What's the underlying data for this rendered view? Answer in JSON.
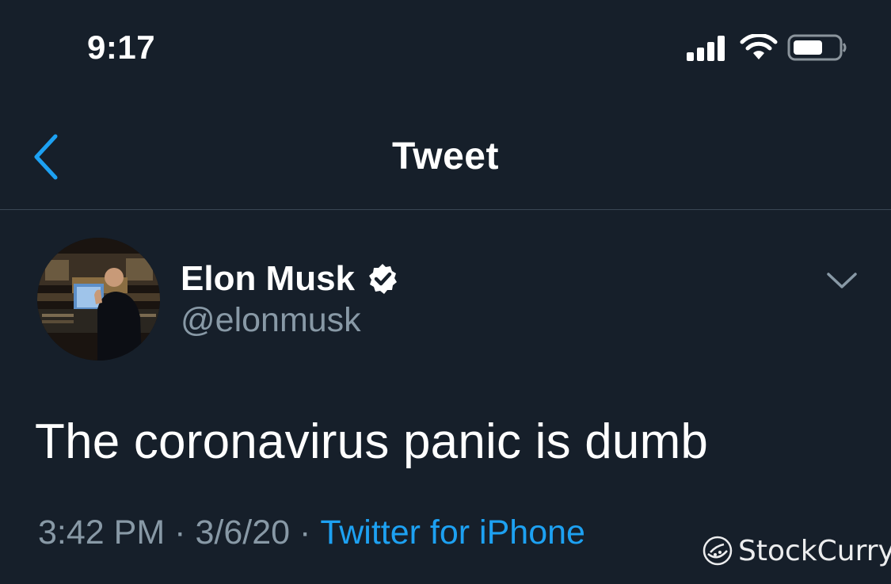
{
  "status_bar": {
    "time": "9:17",
    "icons": [
      "cellular-signal-icon",
      "wifi-icon",
      "battery-icon"
    ]
  },
  "nav": {
    "back_icon": "chevron-left-icon",
    "title": "Tweet"
  },
  "tweet": {
    "author": {
      "display_name": "Elon Musk",
      "verified": true,
      "handle": "@elonmusk"
    },
    "menu_icon": "chevron-down-icon",
    "text": "The coronavirus panic is dumb",
    "time": "3:42 PM",
    "separator": "·",
    "date": "3/6/20",
    "source": "Twitter for iPhone"
  },
  "watermark": {
    "text": "StockCurry"
  },
  "colors": {
    "background": "#161f2a",
    "accent": "#1da1f2",
    "secondary_text": "#8899a6",
    "divider": "#3a4654"
  }
}
